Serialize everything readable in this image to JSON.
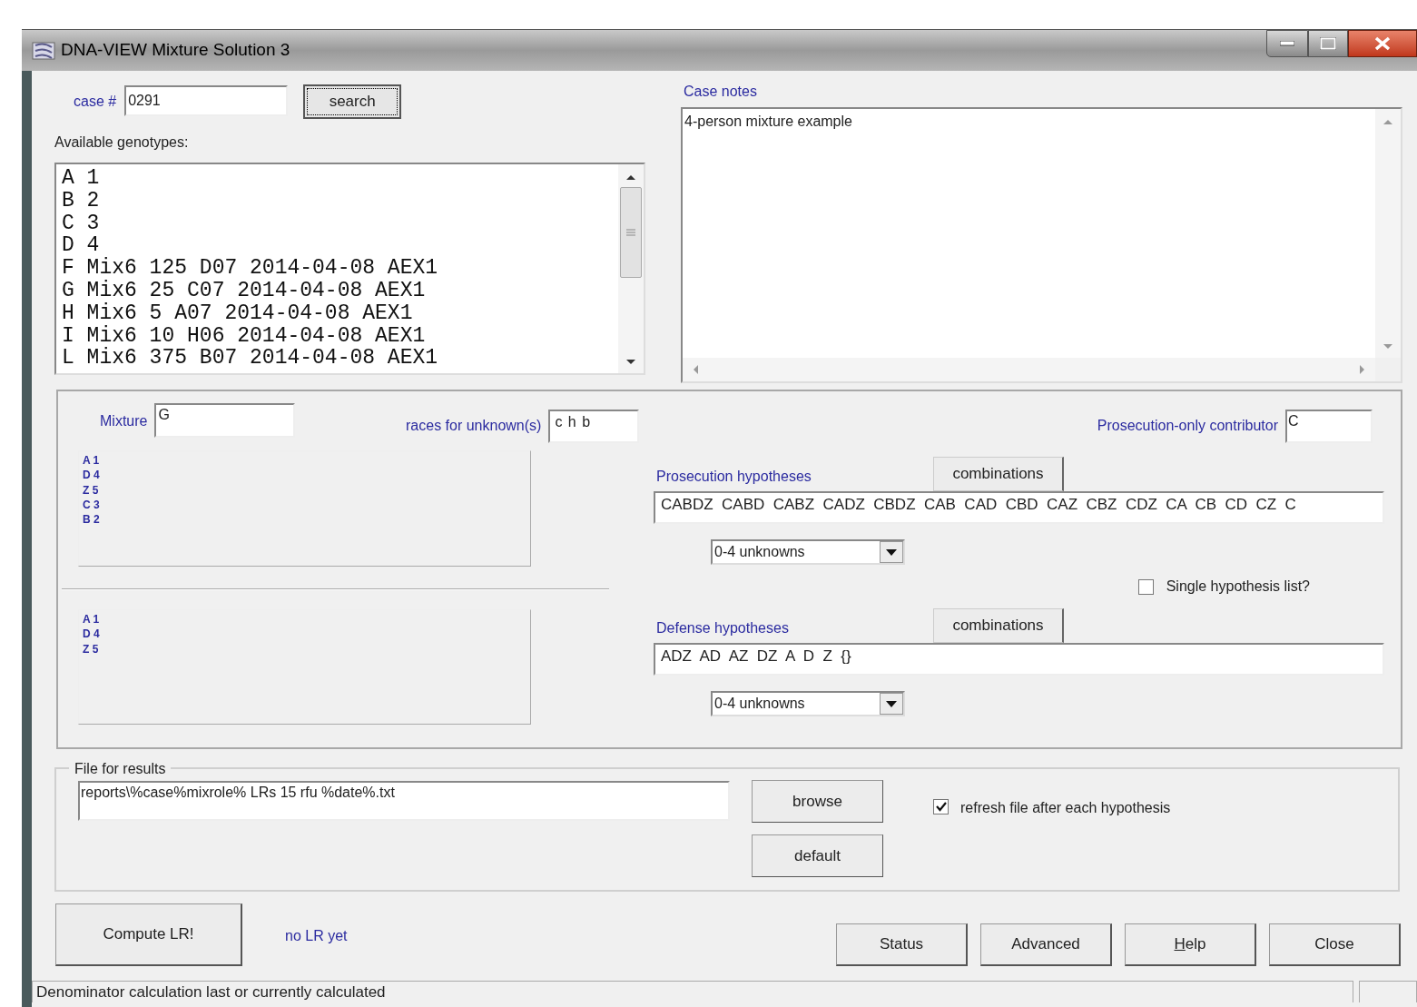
{
  "window": {
    "title": "DNA-VIEW Mixture Solution 3"
  },
  "case": {
    "label": "case #",
    "value": "0291",
    "button": "search"
  },
  "genotypes": {
    "label": "Available genotypes:",
    "items": [
      "A 1",
      "B 2",
      "C 3",
      "D 4",
      "F Mix6 125 D07 2014-04-08 AEX1",
      "G Mix6 25 C07 2014-04-08 AEX1",
      "H Mix6 5 A07 2014-04-08 AEX1",
      "I Mix6 10 H06 2014-04-08 AEX1",
      "L Mix6 375 B07 2014-04-08 AEX1"
    ]
  },
  "case_notes": {
    "label": "Case notes",
    "value": "4-person mixture example"
  },
  "mixture": {
    "label": "Mixture",
    "value": "G",
    "prosecution_contributors": [
      "A 1",
      "D 4",
      "Z 5",
      "C 3",
      "B 2"
    ],
    "defense_contributors": [
      "A 1",
      "D 4",
      "Z 5"
    ]
  },
  "races": {
    "label": "races for unknown(s)",
    "value": "c h b"
  },
  "prosecution_only": {
    "label": "Prosecution-only contributor",
    "value": "C"
  },
  "prosecution_hypotheses": {
    "label": "Prosecution hypotheses",
    "button": "combinations",
    "value": "CABDZ  CABD  CABZ  CADZ  CBDZ  CAB  CAD  CBD  CAZ  CBZ  CDZ  CA  CB  CD  CZ  C",
    "unknowns": "0-4 unknowns"
  },
  "single_hypothesis_list": {
    "label": "Single hypothesis list?",
    "checked": false
  },
  "defense_hypotheses": {
    "label": "Defense hypotheses",
    "button": "combinations",
    "value": "ADZ  AD  AZ  DZ  A  D  Z  {}",
    "unknowns": "0-4 unknowns"
  },
  "results_file": {
    "legend": "File for results",
    "value": "reports\\%case%mixrole% LRs 15 rfu %date%.txt",
    "buttons": [
      "browse",
      "default"
    ],
    "refresh": {
      "label": "refresh file after each hypothesis",
      "checked": true
    }
  },
  "compute": {
    "button": "Compute LR!",
    "result": "no LR yet"
  },
  "buttons": [
    {
      "label": "Status",
      "mnemonic": false
    },
    {
      "label": "Advanced",
      "mnemonic": false
    },
    {
      "label": "Help",
      "mnemonic": true
    },
    {
      "label": "Close",
      "mnemonic": false
    }
  ],
  "status_bar": "Denominator calculation last or currently calculated"
}
